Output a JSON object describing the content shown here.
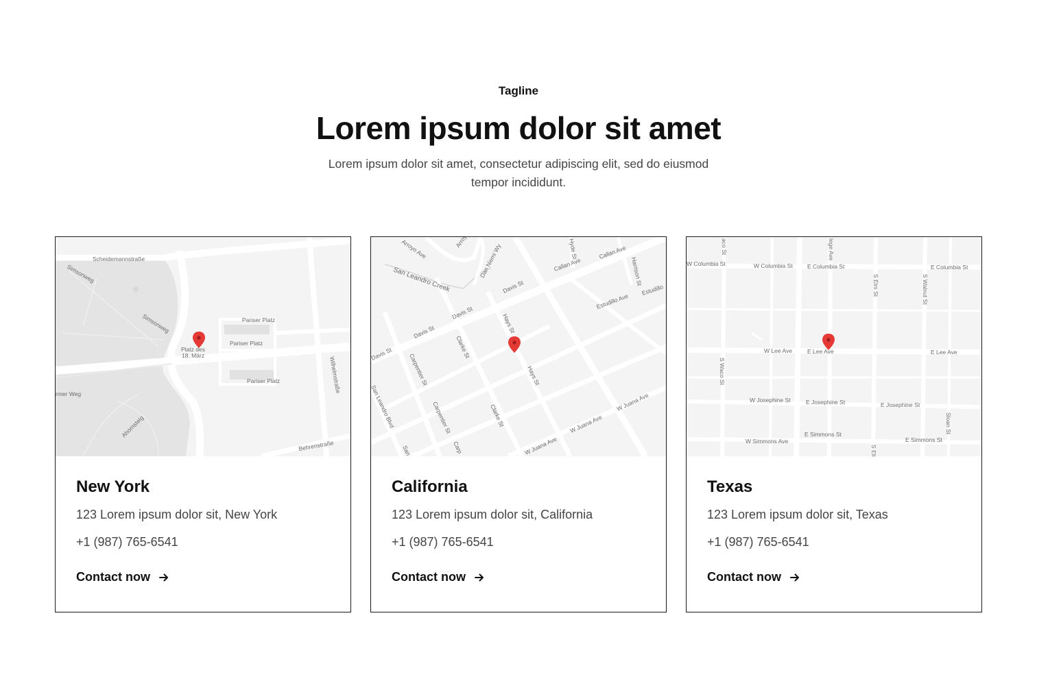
{
  "header": {
    "tagline": "Tagline",
    "title": "Lorem ipsum dolor sit amet",
    "subtitle": "Lorem ipsum dolor sit amet, consectetur adipiscing elit, sed do eiusmod tempor incididunt."
  },
  "colors": {
    "text": "#111111",
    "muted": "#444444",
    "border": "#1a1a1a",
    "map_bg": "#f4f4f4",
    "map_park": "#e4e4e4",
    "pin": "#e53935"
  },
  "locations": [
    {
      "city": "New York",
      "address": "123 Lorem ipsum dolor sit, New York",
      "phone": "+1 (987) 765-6541",
      "cta": "Contact now",
      "map_labels": {
        "l1": "Scheidemannstraße",
        "l2": "Simsonweg",
        "l3": "Simsonweg",
        "l4": "Pariser Platz",
        "l5": "Pariser Platz",
        "l6": "Pariser Platz",
        "l7": "Platz des",
        "l8": "18. März",
        "l9": "Wilhelmstraße",
        "l10": "rmer Weg",
        "l11": "Ahornsteig",
        "l12": "Behrenstraße"
      }
    },
    {
      "city": "California",
      "address": "123 Lorem ipsum dolor sit, California",
      "phone": "+1 (987) 765-6541",
      "cta": "Contact now",
      "map_labels": {
        "l1": "Arroyo Ave",
        "l2": "Arroyo",
        "l3": "Dan Niemi Wy",
        "l4": "Hyde St",
        "l5": "Callan Ave",
        "l6": "Callan Ave",
        "l7": "Harrison St",
        "l8": "San Leandro Creek",
        "l9": "Davis St",
        "l10": "Estudillo Ave",
        "l11": "Estudillo",
        "l12": "Davis St",
        "l13": "Davis St",
        "l14": "Davis St",
        "l15": "Hays St",
        "l16": "Clarke St",
        "l17": "Carpentier St",
        "l18": "Hays St",
        "l19": "San Leandro Blvd",
        "l20": "Carpentier St",
        "l21": "Clarke St",
        "l22": "W Juana Ave",
        "l23": "W Juana Ave",
        "l24": "W Juana Ave",
        "l25": "Carp",
        "l26": "San"
      }
    },
    {
      "city": "Texas",
      "address": "123 Lorem ipsum dolor sit, Texas",
      "phone": "+1 (987) 765-6541",
      "cta": "Contact now",
      "map_labels": {
        "l1": "aco St",
        "l2": "lege Ave",
        "l3": "W Columbia St",
        "l4": "W Columbia St",
        "l5": "E Columbia St",
        "l6": "E Columbia St",
        "l7": "S Elm St",
        "l8": "S Walnut St",
        "l9": "W Lee Ave",
        "l10": "E Lee Ave",
        "l11": "E Lee Ave",
        "l12": "S Waco St",
        "l13": "W Josephine St",
        "l14": "E Josephine St",
        "l15": "E Josephine St",
        "l16": "Sloan St",
        "l17": "E Simmons St",
        "l18": "E Simmons St",
        "l19": "W Simmons Ave",
        "l20": "S Elt"
      }
    }
  ]
}
